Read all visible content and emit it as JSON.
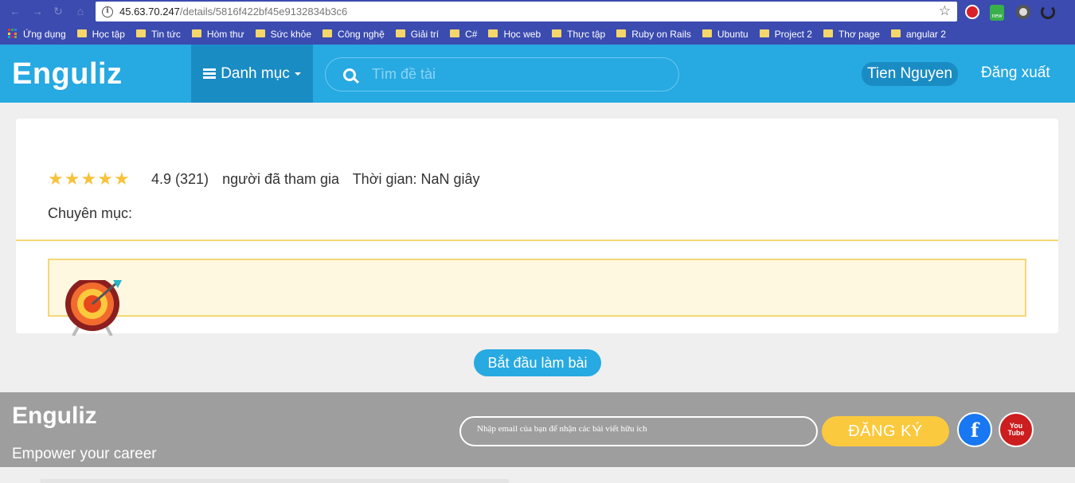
{
  "browser": {
    "url_host": "45.63.70.247",
    "url_path": "/details/5816f422bf45e9132834b3c6",
    "info_glyph": "i",
    "star_glyph": "☆",
    "bookmarks": [
      {
        "label": "Ứng dụng",
        "type": "apps"
      },
      {
        "label": "Học tập",
        "type": "folder"
      },
      {
        "label": "Tin tức",
        "type": "folder"
      },
      {
        "label": "Hòm thư",
        "type": "folder"
      },
      {
        "label": "Sức khỏe",
        "type": "folder"
      },
      {
        "label": "Công nghệ",
        "type": "folder"
      },
      {
        "label": "Giải trí",
        "type": "folder"
      },
      {
        "label": "C#",
        "type": "folder"
      },
      {
        "label": "Học web",
        "type": "folder"
      },
      {
        "label": "Thực tập",
        "type": "folder"
      },
      {
        "label": "Ruby on Rails",
        "type": "folder"
      },
      {
        "label": "Ubuntu",
        "type": "folder"
      },
      {
        "label": "Project 2",
        "type": "folder"
      },
      {
        "label": "Thơ page",
        "type": "folder"
      },
      {
        "label": "angular 2",
        "type": "folder"
      }
    ],
    "ext_badge": "new"
  },
  "header": {
    "logo": "Enguliz",
    "menu_label": "Danh mục",
    "search_placeholder": "Tìm đề tài",
    "user_name": "Tien Nguyen",
    "logout_label": "Đăng xuất"
  },
  "details": {
    "rating_stars": 5,
    "rating_text": "4.9 (321)",
    "participants_label": "người đã tham gia",
    "time_label": "Thời gian: NaN giây",
    "category_label": "Chuyên mục:"
  },
  "actions": {
    "start_label": "Bắt đầu làm bài"
  },
  "footer": {
    "logo": "Enguliz",
    "tagline": "Empower your career",
    "email_placeholder": "Nhập email của bạn để nhận các bài viết hữu ích",
    "subscribe_label": "ĐĂNG KÝ",
    "facebook_glyph": "f",
    "youtube_text": "You\nTube"
  },
  "colors": {
    "brand": "#27a9e1",
    "brand_dark": "#1a8cc4",
    "star": "#f9c23c",
    "accent_yellow": "#fbc93d",
    "footer_bg": "#9e9e9e",
    "chrome": "#3b4bb0"
  }
}
